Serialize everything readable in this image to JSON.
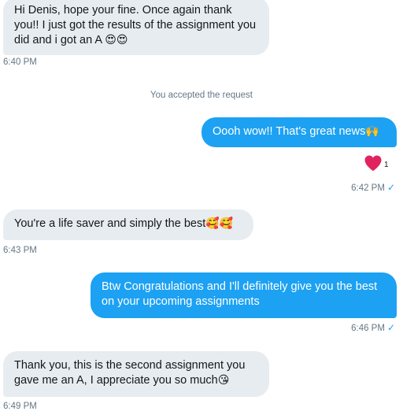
{
  "conversation": {
    "messages": [
      {
        "direction": "incoming",
        "text": "Hi Denis, hope your fine. Once again thank you!! I just got the results of the assignment you did and i got an A",
        "emoji": "😍😍",
        "time": "6:40 PM"
      },
      {
        "direction": "system",
        "text": "You accepted the request"
      },
      {
        "direction": "outgoing",
        "text": "Oooh wow!! That's great news",
        "emoji": "🙌",
        "time": "6:42 PM",
        "reaction": {
          "icon": "heart-icon",
          "count": "1",
          "color": "#e0245e"
        }
      },
      {
        "direction": "incoming",
        "text": "You're a life saver and simply the best",
        "emoji": "🥰🥰",
        "time": "6:43 PM"
      },
      {
        "direction": "outgoing",
        "text": "Btw Congratulations and I'll definitely give you the best on your upcoming assignments",
        "time": "6:46 PM"
      },
      {
        "direction": "incoming",
        "text": "Thank you, this is the second assignment you gave me an A, I appreciate you so much",
        "emoji": "😘",
        "time": "6:49 PM"
      }
    ],
    "read_check": "✓"
  },
  "colors": {
    "incoming_bubble": "#e6ecf0",
    "outgoing_bubble": "#1da1f2",
    "timestamp": "#657786"
  }
}
